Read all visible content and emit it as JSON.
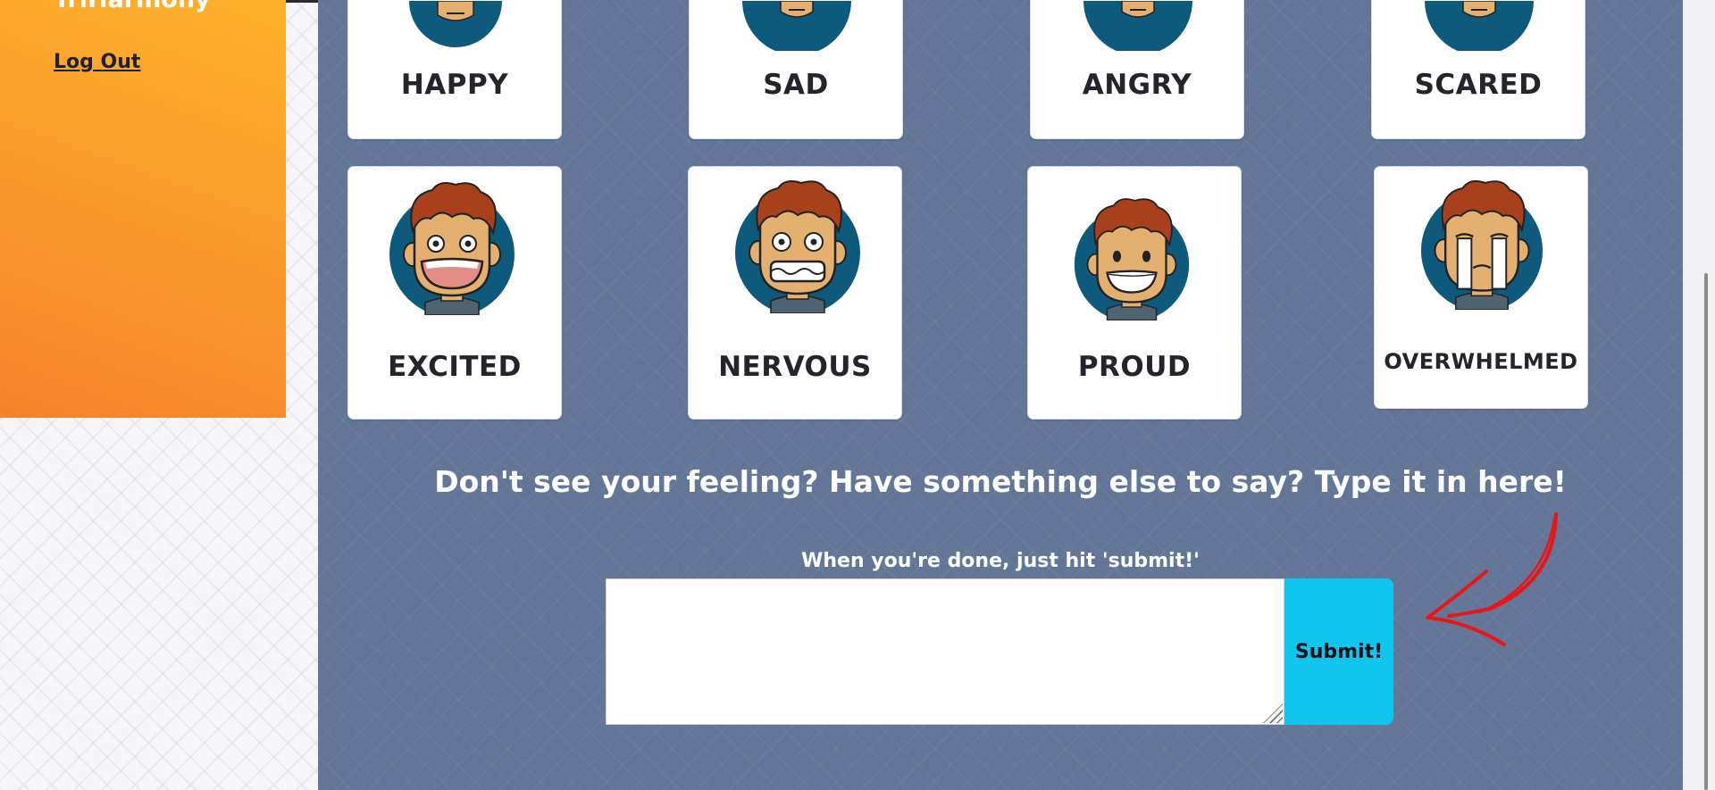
{
  "sidebar": {
    "brand": "TriHarmony",
    "logout_label": "Log Out"
  },
  "emotions": {
    "happy": "HAPPY",
    "sad": "SAD",
    "angry": "ANGRY",
    "scared": "SCARED",
    "excited": "EXCITED",
    "nervous": "NERVOUS",
    "proud": "PROUD",
    "overwhelmed": "OVERWHELMED"
  },
  "feedback": {
    "prompt": "Don't see your feeling? Have something else to say? Type it in here!",
    "hint": "When you're done, just hit 'submit!'",
    "value": "",
    "submit_label": "Submit!"
  },
  "colors": {
    "sidebar_orange": "#fcb22c",
    "panel_blue": "#637697",
    "submit_cyan": "#10c6ee",
    "arrow_red": "#e81616"
  },
  "icons": {
    "arrow": "red-curved-arrow-icon",
    "avatar": "boy-face-icon"
  }
}
